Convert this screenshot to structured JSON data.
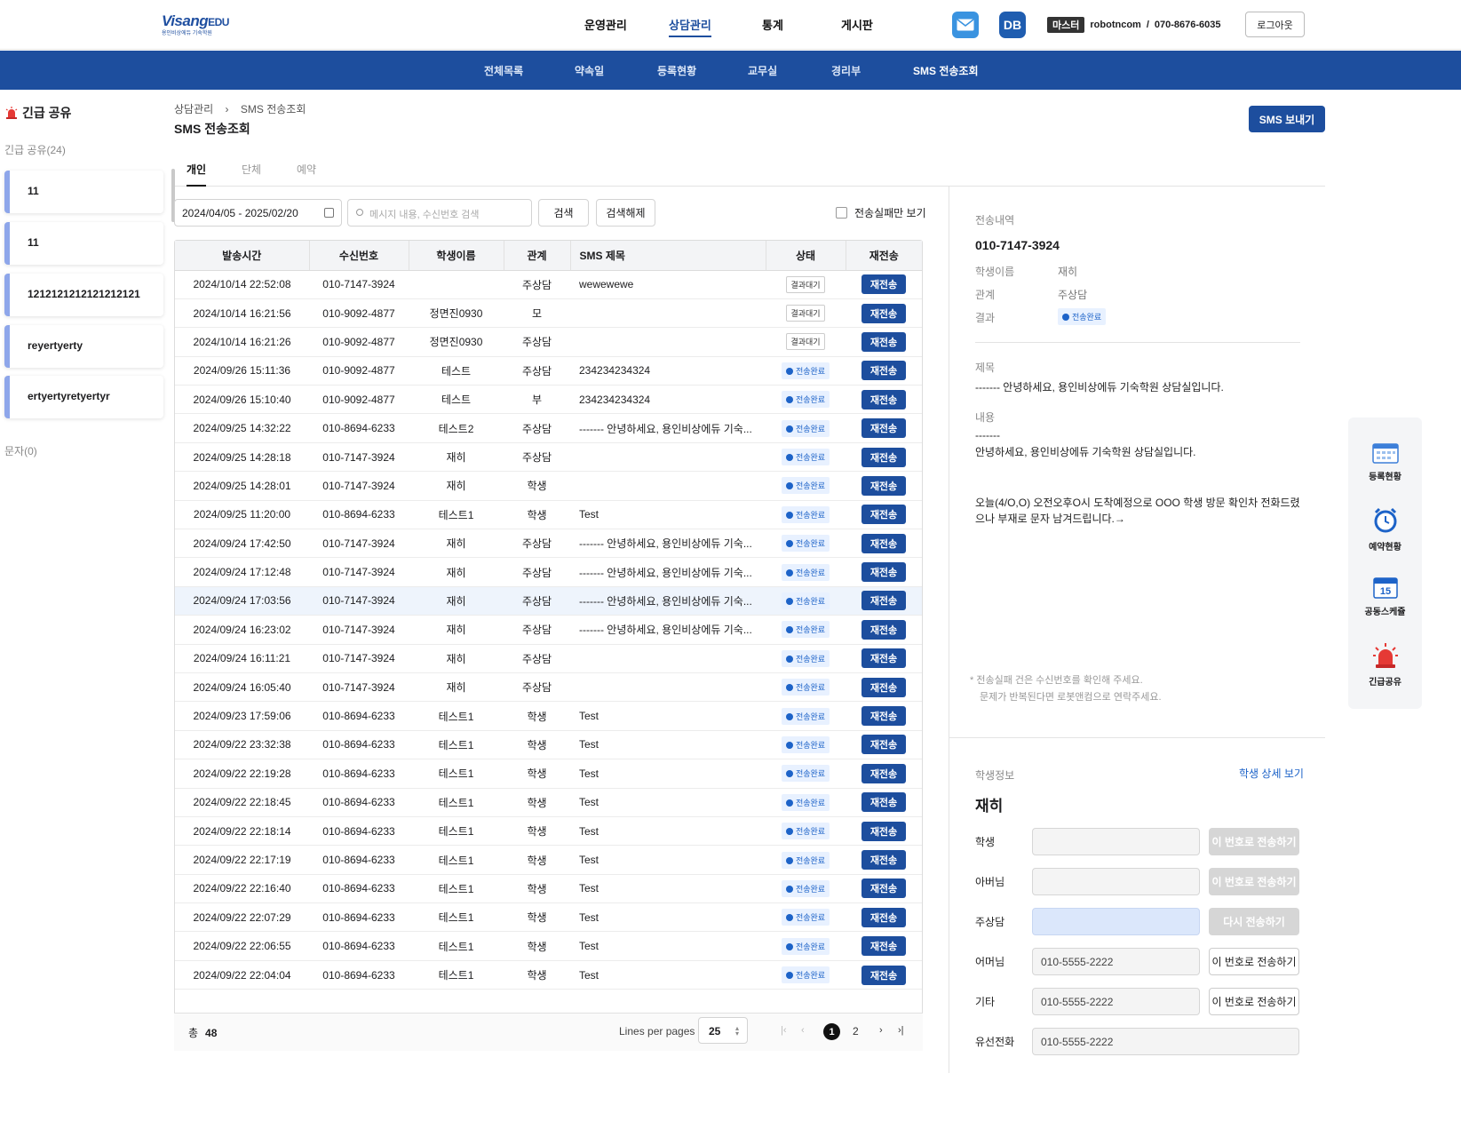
{
  "header": {
    "logo_main": "Visang",
    "logo_sub": "EDU",
    "logo_tagline": "용인비상에듀 기숙학원",
    "nav": [
      {
        "label": "운영관리",
        "active": false
      },
      {
        "label": "상담관리",
        "active": true
      },
      {
        "label": "통계",
        "active": false
      },
      {
        "label": "게시판",
        "active": false
      }
    ],
    "db_label": "DB",
    "role_badge": "마스터",
    "user_id": "robotncom",
    "separator": "/",
    "phone": "070-8676-6035",
    "logout": "로그아웃"
  },
  "subnav": [
    {
      "label": "전체목록",
      "active": false
    },
    {
      "label": "약속일",
      "active": false
    },
    {
      "label": "등록현황",
      "active": false
    },
    {
      "label": "교무실",
      "active": false
    },
    {
      "label": "경리부",
      "active": false
    },
    {
      "label": "SMS 전송조회",
      "active": true
    }
  ],
  "left": {
    "title": "긴급 공유",
    "count_label": "긴급 공유(24)",
    "cards": [
      "11",
      "11",
      "1212121212121212121",
      "reyertyerty",
      "ertyertyretyertyr"
    ],
    "message_label": "문자(0)"
  },
  "breadcrumb": {
    "parent": "상담관리",
    "sep": "›",
    "current": "SMS 전송조회"
  },
  "page_title": "SMS 전송조회",
  "sms_send_button": "SMS 보내기",
  "tabs": [
    {
      "label": "개인",
      "active": true
    },
    {
      "label": "단체",
      "active": false
    },
    {
      "label": "예약",
      "active": false
    }
  ],
  "filters": {
    "date_range": "2024/04/05 - 2025/02/20",
    "search_placeholder": "메시지 내용, 수신번호 검색",
    "search_btn": "검색",
    "reset_btn": "검색해제",
    "fail_only": "전송실패만 보기"
  },
  "table": {
    "columns": [
      "발송시간",
      "수신번호",
      "학생이름",
      "관계",
      "SMS 제목",
      "상태",
      "재전송"
    ],
    "resend_label": "재전송",
    "status_wait": "결과대기",
    "status_done": "전송완료",
    "rows": [
      {
        "time": "2024/10/14 22:52:08",
        "phone": "010-7147-3924",
        "name": "",
        "rel": "주상담",
        "subject": "wewewewe",
        "status": "wait"
      },
      {
        "time": "2024/10/14 16:21:56",
        "phone": "010-9092-4877",
        "name": "정면진0930",
        "rel": "모",
        "subject": "",
        "status": "wait"
      },
      {
        "time": "2024/10/14 16:21:26",
        "phone": "010-9092-4877",
        "name": "정면진0930",
        "rel": "주상담",
        "subject": "",
        "status": "wait"
      },
      {
        "time": "2024/09/26 15:11:36",
        "phone": "010-9092-4877",
        "name": "테스트",
        "rel": "주상담",
        "subject": "234234234324",
        "status": "done"
      },
      {
        "time": "2024/09/26 15:10:40",
        "phone": "010-9092-4877",
        "name": "테스트",
        "rel": "부",
        "subject": "234234234324",
        "status": "done"
      },
      {
        "time": "2024/09/25 14:32:22",
        "phone": "010-8694-6233",
        "name": "테스트2",
        "rel": "주상담",
        "subject": "------- 안녕하세요, 용인비상에듀 기숙...",
        "status": "done"
      },
      {
        "time": "2024/09/25 14:28:18",
        "phone": "010-7147-3924",
        "name": "재히",
        "rel": "주상담",
        "subject": "",
        "status": "done"
      },
      {
        "time": "2024/09/25 14:28:01",
        "phone": "010-7147-3924",
        "name": "재히",
        "rel": "학생",
        "subject": "",
        "status": "done"
      },
      {
        "time": "2024/09/25 11:20:00",
        "phone": "010-8694-6233",
        "name": "테스트1",
        "rel": "학생",
        "subject": "Test",
        "status": "done"
      },
      {
        "time": "2024/09/24 17:42:50",
        "phone": "010-7147-3924",
        "name": "재히",
        "rel": "주상담",
        "subject": "------- 안녕하세요, 용인비상에듀 기숙...",
        "status": "done"
      },
      {
        "time": "2024/09/24 17:12:48",
        "phone": "010-7147-3924",
        "name": "재히",
        "rel": "주상담",
        "subject": "------- 안녕하세요, 용인비상에듀 기숙...",
        "status": "done"
      },
      {
        "time": "2024/09/24 17:03:56",
        "phone": "010-7147-3924",
        "name": "재히",
        "rel": "주상담",
        "subject": "------- 안녕하세요, 용인비상에듀 기숙...",
        "status": "done",
        "selected": true
      },
      {
        "time": "2024/09/24 16:23:02",
        "phone": "010-7147-3924",
        "name": "재히",
        "rel": "주상담",
        "subject": "------- 안녕하세요, 용인비상에듀 기숙...",
        "status": "done"
      },
      {
        "time": "2024/09/24 16:11:21",
        "phone": "010-7147-3924",
        "name": "재히",
        "rel": "주상담",
        "subject": "",
        "status": "done"
      },
      {
        "time": "2024/09/24 16:05:40",
        "phone": "010-7147-3924",
        "name": "재히",
        "rel": "주상담",
        "subject": "",
        "status": "done"
      },
      {
        "time": "2024/09/23 17:59:06",
        "phone": "010-8694-6233",
        "name": "테스트1",
        "rel": "학생",
        "subject": "Test",
        "status": "done"
      },
      {
        "time": "2024/09/22 23:32:38",
        "phone": "010-8694-6233",
        "name": "테스트1",
        "rel": "학생",
        "subject": "Test",
        "status": "done"
      },
      {
        "time": "2024/09/22 22:19:28",
        "phone": "010-8694-6233",
        "name": "테스트1",
        "rel": "학생",
        "subject": "Test",
        "status": "done"
      },
      {
        "time": "2024/09/22 22:18:45",
        "phone": "010-8694-6233",
        "name": "테스트1",
        "rel": "학생",
        "subject": "Test",
        "status": "done"
      },
      {
        "time": "2024/09/22 22:18:14",
        "phone": "010-8694-6233",
        "name": "테스트1",
        "rel": "학생",
        "subject": "Test",
        "status": "done"
      },
      {
        "time": "2024/09/22 22:17:19",
        "phone": "010-8694-6233",
        "name": "테스트1",
        "rel": "학생",
        "subject": "Test",
        "status": "done"
      },
      {
        "time": "2024/09/22 22:16:40",
        "phone": "010-8694-6233",
        "name": "테스트1",
        "rel": "학생",
        "subject": "Test",
        "status": "done"
      },
      {
        "time": "2024/09/22 22:07:29",
        "phone": "010-8694-6233",
        "name": "테스트1",
        "rel": "학생",
        "subject": "Test",
        "status": "done"
      },
      {
        "time": "2024/09/22 22:06:55",
        "phone": "010-8694-6233",
        "name": "테스트1",
        "rel": "학생",
        "subject": "Test",
        "status": "done"
      },
      {
        "time": "2024/09/22 22:04:04",
        "phone": "010-8694-6233",
        "name": "테스트1",
        "rel": "학생",
        "subject": "Test",
        "status": "done"
      }
    ]
  },
  "footer": {
    "total_label": "총",
    "total": "48",
    "lines_label": "Lines per pages",
    "lines_value": "25",
    "pages": [
      "1",
      "2"
    ],
    "current_page": "1"
  },
  "detail": {
    "section_label": "전송내역",
    "phone": "010-7147-3924",
    "name_label": "학생이름",
    "name": "재히",
    "rel_label": "관계",
    "rel": "주상담",
    "result_label": "결과",
    "result": "전송완료",
    "title_label": "제목",
    "title": "------- 안녕하세요, 용인비상에듀 기숙학원 상담실입니다.",
    "content_label": "내용",
    "content_line1": "-------",
    "content_line2": "안녕하세요, 용인비상에듀 기숙학원 상담실입니다.",
    "content_line3": "오늘(4/O,O) 오전오후O시 도착예정으로 OOO 학생 방문 확인차 전화드렸으나 부재로 문자 남겨드립니다.→",
    "note_line1": "* 전송실패 건은 수신번호를 확인해 주세요.",
    "note_line2": "문제가 반복된다면 로봇앤컴으로 연락주세요."
  },
  "student": {
    "section_label": "학생정보",
    "detail_link": "학생 상세 보기",
    "name": "재히",
    "fields": [
      {
        "label": "학생",
        "value": "",
        "button": "이 번호로 전송하기",
        "state": "disabled"
      },
      {
        "label": "아버님",
        "value": "",
        "button": "이 번호로 전송하기",
        "state": "disabled"
      },
      {
        "label": "주상담",
        "value": "",
        "button": "다시 전송하기",
        "state": "disabled",
        "highlight": true
      },
      {
        "label": "어머님",
        "value": "010-5555-2222",
        "button": "이 번호로 전송하기",
        "state": "enabled"
      },
      {
        "label": "기타",
        "value": "010-5555-2222",
        "button": "이 번호로 전송하기",
        "state": "enabled"
      },
      {
        "label": "유선전화",
        "value": "010-5555-2222"
      }
    ]
  },
  "quick_menu": [
    {
      "label": "등록현황",
      "icon": "calendar-grid-icon"
    },
    {
      "label": "예약현황",
      "icon": "alarm-clock-icon"
    },
    {
      "label": "공동스케쥴",
      "icon": "calendar-15-icon",
      "day": "15"
    },
    {
      "label": "긴급공유",
      "icon": "siren-icon"
    }
  ],
  "colors": {
    "primary": "#1d4e9e",
    "accent_blue": "#1d63c8",
    "card_border": "#8ea6ea",
    "siren": "#e53935"
  }
}
